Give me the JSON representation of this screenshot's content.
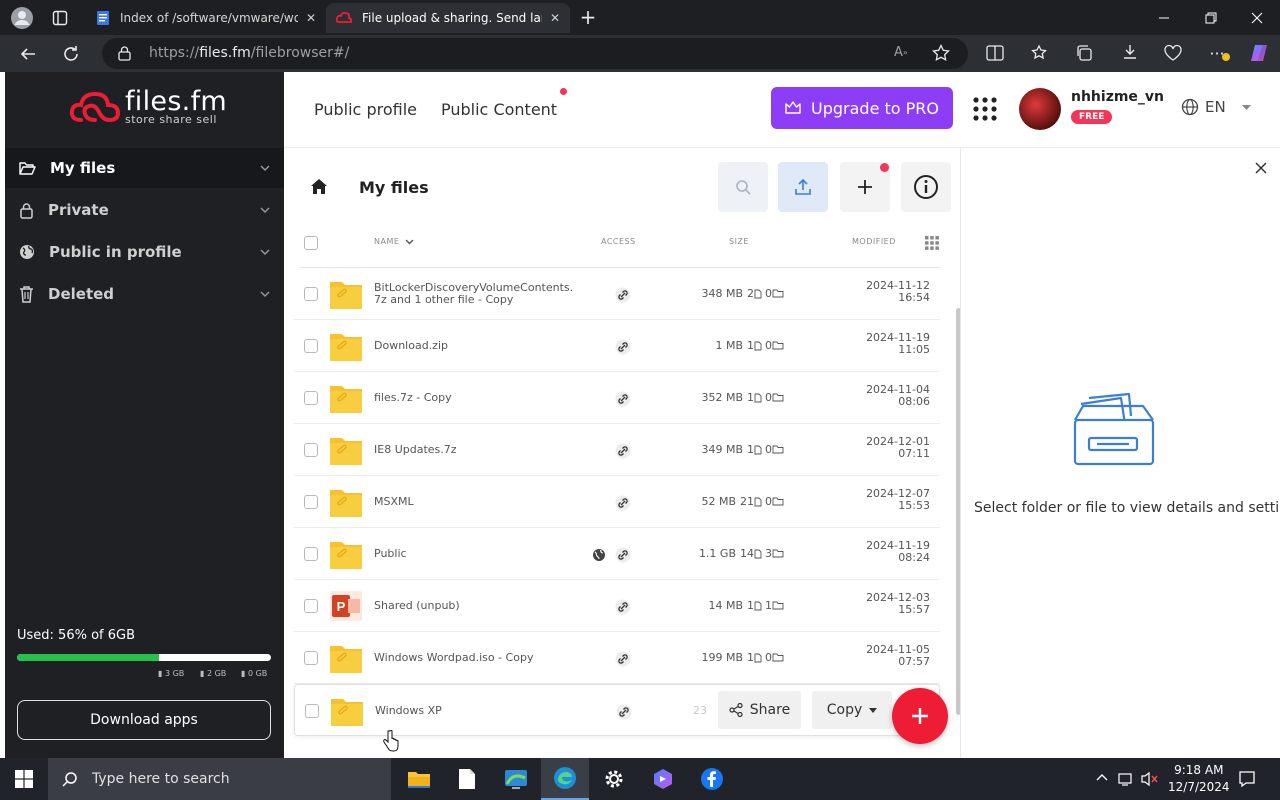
{
  "browser": {
    "tabs": [
      {
        "label": "Index of /software/vmware/works",
        "active": false
      },
      {
        "label": "File upload & sharing. Send large",
        "active": true
      }
    ],
    "url_prefix": "https://",
    "url_host": "files.fm",
    "url_path": "/filebrowser#/"
  },
  "app": {
    "logo_name": "files.fm",
    "logo_tagline": "store share sell",
    "brand_color": "#ee1c35",
    "sidebar": {
      "items": [
        {
          "label": "My files",
          "icon": "folder-open-icon",
          "active": true
        },
        {
          "label": "Private",
          "icon": "lock-icon",
          "active": false
        },
        {
          "label": "Public in profile",
          "icon": "globe-icon",
          "active": false
        },
        {
          "label": "Deleted",
          "icon": "trash-icon",
          "active": false
        }
      ],
      "storage": {
        "used_label": "Used: 56% of 6GB",
        "used_fraction": 0.56,
        "legend": [
          "3 GB",
          "2 GB",
          "0 GB"
        ]
      },
      "download_apps": "Download apps"
    },
    "topnav": {
      "links": [
        "Public profile",
        "Public Content"
      ],
      "upgrade": "Upgrade to PRO",
      "username": "nhhizme_vn",
      "plan_badge": "FREE",
      "language": "EN"
    },
    "filebrowser": {
      "title": "My files",
      "columns": {
        "name": "NAME",
        "access": "ACCESS",
        "size": "SIZE",
        "modified": "MODIFIED"
      },
      "rows": [
        {
          "name": "BitLockerDiscoveryVolumeContents.\n7z and 1 other file - Copy",
          "size_main": "348 MB",
          "files": "2",
          "folders": "0",
          "date": "2024-11-12",
          "time": "16:54",
          "public": false,
          "type": "folder"
        },
        {
          "name": "Download.zip",
          "size_main": "1 MB",
          "files": "1",
          "folders": "0",
          "date": "2024-11-19",
          "time": "11:05",
          "public": false,
          "type": "folder"
        },
        {
          "name": "files.7z - Copy",
          "size_main": "352 MB",
          "files": "1",
          "folders": "0",
          "date": "2024-11-04",
          "time": "08:06",
          "public": false,
          "type": "folder"
        },
        {
          "name": "IE8 Updates.7z",
          "size_main": "349 MB",
          "files": "1",
          "folders": "0",
          "date": "2024-12-01",
          "time": "07:11",
          "public": false,
          "type": "folder"
        },
        {
          "name": "MSXML",
          "size_main": "52 MB",
          "files": "21",
          "folders": "0",
          "date": "2024-12-07",
          "time": "15:53",
          "public": false,
          "type": "folder"
        },
        {
          "name": "Public",
          "size_main": "1.1 GB",
          "files": "14",
          "folders": "3",
          "date": "2024-11-19",
          "time": "08:24",
          "public": true,
          "type": "folder"
        },
        {
          "name": "Shared (unpub)",
          "size_main": "14 MB",
          "files": "1",
          "folders": "1",
          "date": "2024-12-03",
          "time": "15:57",
          "public": false,
          "type": "ppt"
        },
        {
          "name": "Windows Wordpad.iso - Copy",
          "size_main": "199 MB",
          "files": "1",
          "folders": "0",
          "date": "2024-11-05",
          "time": "07:57",
          "public": false,
          "type": "folder"
        },
        {
          "name": "Windows XP",
          "size_main": "23",
          "files": "",
          "folders": "",
          "date": "",
          "time": "",
          "public": false,
          "type": "folder"
        }
      ],
      "row_actions": {
        "share": "Share",
        "copy": "Copy"
      }
    },
    "details": {
      "empty_text": "Select folder or file to view details and settings"
    }
  },
  "taskbar": {
    "search_placeholder": "Type here to search",
    "time": "9:18 AM",
    "date": "12/7/2024"
  }
}
